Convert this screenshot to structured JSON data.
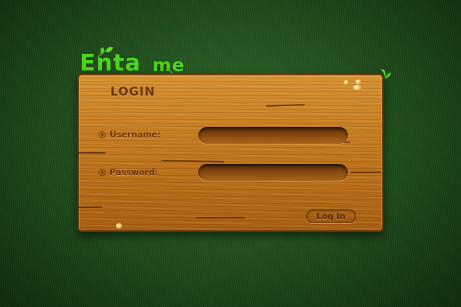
{
  "logo": {
    "word1": "Enta",
    "word2": "me"
  },
  "form": {
    "title": "LOGIN",
    "username_label": "Username:",
    "password_label": "Password:",
    "username_value": "",
    "password_value": "",
    "login_button": "Log In"
  },
  "colors": {
    "grass": "#23531f",
    "wood": "#c77e22",
    "logo_green": "#4fd21f",
    "wood_text": "#6a3508"
  }
}
